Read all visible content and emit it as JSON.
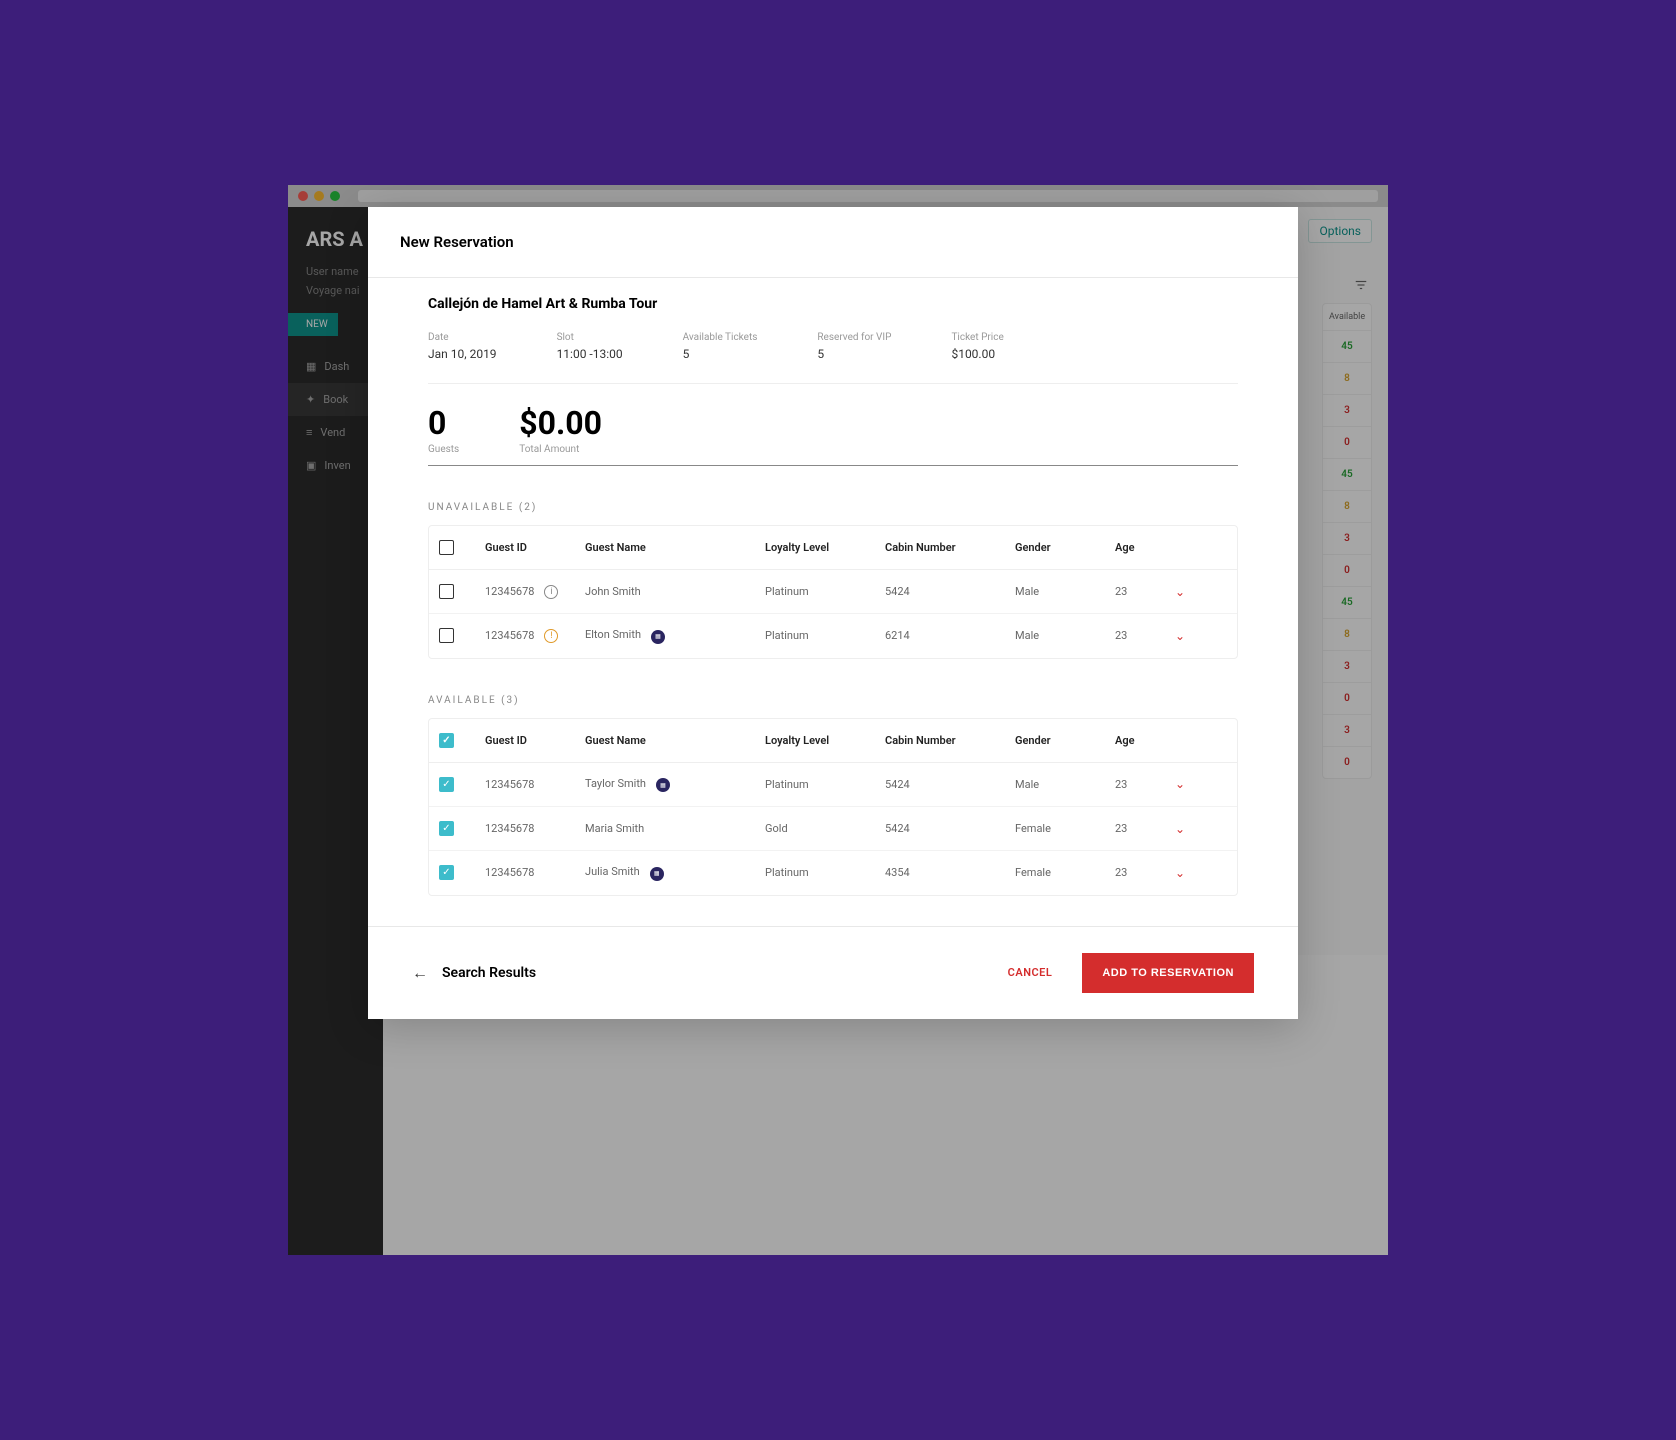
{
  "sidebar": {
    "title": "ARS A",
    "username_label": "User name",
    "voyage_label": "Voyage nai",
    "new_label": "NEW",
    "nav": [
      "Dash",
      "Book",
      "Vend",
      "Inven"
    ]
  },
  "background": {
    "options_label": "Options",
    "avail_header": "Available",
    "availability": [
      "45",
      "8",
      "3",
      "0",
      "45",
      "8",
      "3",
      "0",
      "45",
      "8",
      "3",
      "0",
      "3",
      "0"
    ]
  },
  "modal": {
    "title": "New Reservation",
    "tour_title": "Callejón de Hamel Art & Rumba Tour",
    "info": {
      "date_label": "Date",
      "date_value": "Jan 10, 2019",
      "slot_label": "Slot",
      "slot_value": "11:00 -13:00",
      "avail_label": "Available Tickets",
      "avail_value": "5",
      "vip_label": "Reserved for VIP",
      "vip_value": "5",
      "price_label": "Ticket Price",
      "price_value": "$100.00"
    },
    "totals": {
      "guests_label": "Guests",
      "guests_value": "0",
      "amount_label": "Total Amount",
      "amount_value": "$0.00"
    },
    "unavailable_label": "UNAVAILABLE (2)",
    "available_label": "AVAILABLE (3)",
    "columns": {
      "guest_id": "Guest ID",
      "name": "Guest Name",
      "loyalty": "Loyalty Level",
      "cabin": "Cabin Number",
      "gender": "Gender",
      "age": "Age"
    },
    "unavailable": [
      {
        "id": "12345678",
        "name": "John  Smith",
        "loyalty": "Platinum",
        "cabin": "5424",
        "gender": "Male",
        "age": "23",
        "icon": "info",
        "badge": false
      },
      {
        "id": "12345678",
        "name": "Elton Smith",
        "loyalty": "Platinum",
        "cabin": "6214",
        "gender": "Male",
        "age": "23",
        "icon": "warn",
        "badge": true
      }
    ],
    "available": [
      {
        "id": "12345678",
        "name": "Taylor Smith",
        "loyalty": "Platinum",
        "cabin": "5424",
        "gender": "Male",
        "age": "23",
        "badge": true
      },
      {
        "id": "12345678",
        "name": "Maria Smith",
        "loyalty": "Gold",
        "cabin": "5424",
        "gender": "Female",
        "age": "23",
        "badge": false
      },
      {
        "id": "12345678",
        "name": "Julia Smith",
        "loyalty": "Platinum",
        "cabin": "4354",
        "gender": "Female",
        "age": "23",
        "badge": true
      }
    ],
    "footer": {
      "search_results": "Search Results",
      "cancel": "CANCEL",
      "add": "ADD TO RESERVATION"
    }
  }
}
